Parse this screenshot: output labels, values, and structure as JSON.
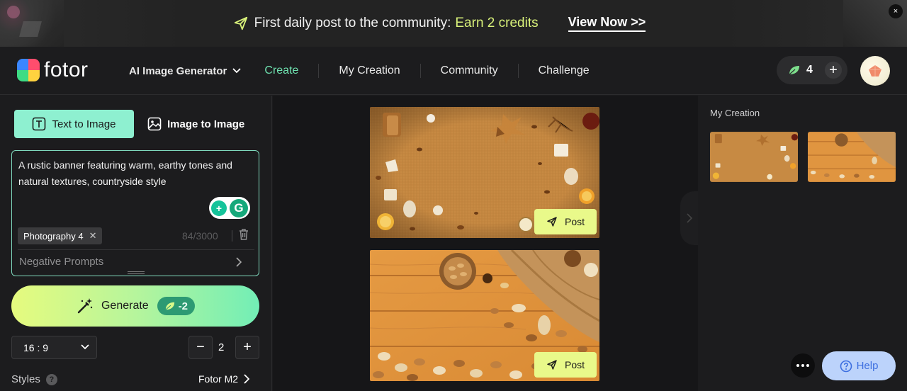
{
  "promo": {
    "message": "First daily post to the community:",
    "accent": "Earn 2 credits",
    "link": "View Now >>",
    "close": "×"
  },
  "header": {
    "brand": "fotor",
    "dropdown": "AI Image Generator",
    "nav": [
      "Create",
      "My Creation",
      "Community",
      "Challenge"
    ],
    "active_nav": "Create",
    "credits": "4",
    "credits_add": "+"
  },
  "left": {
    "tabs": {
      "text_to_image": "Text to Image",
      "image_to_image": "Image to Image"
    },
    "prompt": "A rustic banner featuring warm, earthy tones and natural textures, countryside style",
    "tag": "Photography 4",
    "char_count": "84/3000",
    "negative_prompts": "Negative Prompts",
    "generate": {
      "label": "Generate",
      "cost": "-2"
    },
    "ratio": "16 : 9",
    "quantity": "2",
    "decrement": "−",
    "increment": "+",
    "styles_label": "Styles",
    "styles_help": "?",
    "style_value": "Fotor M2"
  },
  "center": {
    "post_label": "Post"
  },
  "right": {
    "title": "My Creation",
    "help": "Help"
  },
  "colors": {
    "accent_green": "#6fe3b1",
    "post_yellow": "#e9f98a",
    "tab_active": "#8ef0d0",
    "promo_accent": "#d9f27a"
  }
}
